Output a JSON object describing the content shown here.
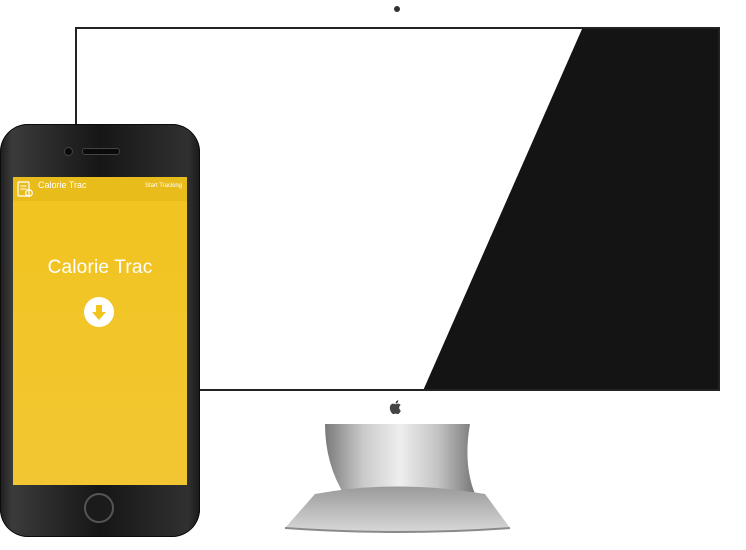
{
  "phone_app": {
    "app_name": "Calorie Trac",
    "nav_link": "Start Tracking",
    "hero_title": "Calorie Trac",
    "logo_icon": "notepad-icon",
    "scroll_icon": "arrow-down-circle-icon",
    "accent_color": "#f1c41f"
  },
  "desktop": {
    "brand_icon": "apple-logo-icon",
    "screen_dark_color": "#141414"
  }
}
